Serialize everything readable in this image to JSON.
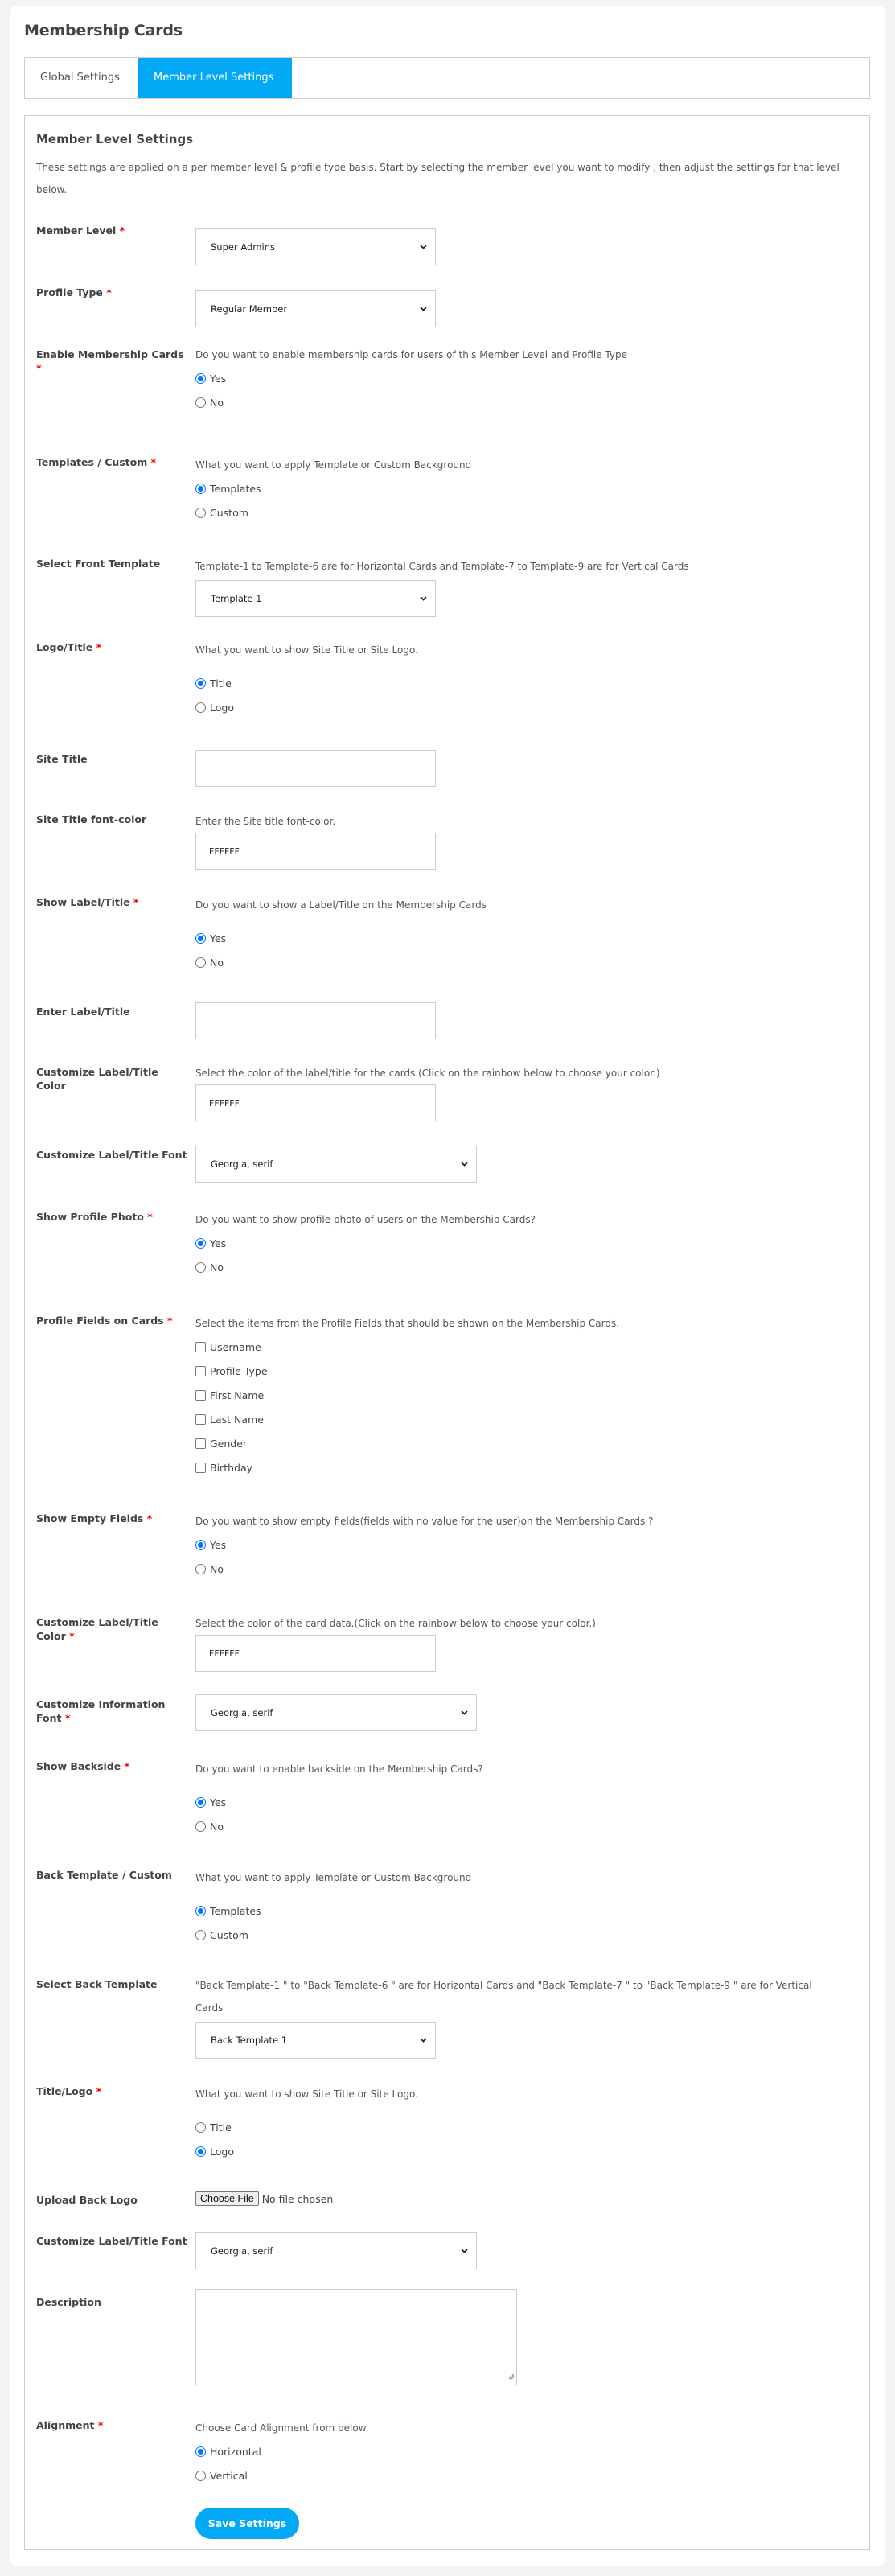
{
  "page": {
    "title": "Membership Cards"
  },
  "tabs": [
    {
      "label": "Global Settings",
      "active": false
    },
    {
      "label": "Member Level Settings",
      "active": true
    }
  ],
  "panel": {
    "title": "Member Level Settings",
    "description": "These settings are applied on a per member level & profile type basis. Start by selecting the member level you want to modify , then adjust the settings for that level below."
  },
  "colors": {
    "accent": "#03a9f4",
    "required": "#ee0000",
    "radio_checked": "#0075ff"
  },
  "fields": {
    "member_level": {
      "label": "Member Level",
      "required": "*",
      "value": "Super Admins"
    },
    "profile_type": {
      "label": "Profile Type",
      "required": "*",
      "value": "Regular Member"
    },
    "enable_cards": {
      "label": "Enable Membership Cards",
      "required": "*",
      "hint": "Do you want to enable membership cards for users of this Member Level and Profile Type",
      "options": [
        {
          "label": "Yes",
          "checked": true
        },
        {
          "label": "No",
          "checked": false
        }
      ]
    },
    "templates_custom": {
      "label": "Templates / Custom",
      "required": "*",
      "hint": "What you want to apply Template or Custom Background",
      "options": [
        {
          "label": "Templates",
          "checked": true
        },
        {
          "label": "Custom",
          "checked": false
        }
      ]
    },
    "front_template": {
      "label": "Select Front Template",
      "hint": "Template-1 to Template-6 are for Horizontal Cards and Template-7 to Template-9 are for Vertical Cards",
      "value": "Template 1"
    },
    "logo_title": {
      "label": "Logo/Title",
      "required": "*",
      "hint": "What you want to show Site Title or Site Logo.",
      "options": [
        {
          "label": "Title",
          "checked": true
        },
        {
          "label": "Logo",
          "checked": false
        }
      ]
    },
    "site_title": {
      "label": "Site Title",
      "value": ""
    },
    "site_title_color": {
      "label": "Site Title font-color",
      "hint": "Enter the Site title font-color.",
      "value": "FFFFFF"
    },
    "show_label": {
      "label": "Show Label/Title",
      "required": "*",
      "hint": "Do you want to show a Label/Title on the Membership Cards",
      "options": [
        {
          "label": "Yes",
          "checked": true
        },
        {
          "label": "No",
          "checked": false
        }
      ]
    },
    "enter_label": {
      "label": "Enter Label/Title",
      "value": ""
    },
    "label_color": {
      "label": "Customize Label/Title Color",
      "hint": "Select the color of the label/title for the cards.(Click on the rainbow below to choose your color.)",
      "value": "FFFFFF"
    },
    "label_font": {
      "label": "Customize Label/Title Font",
      "value": "Georgia, serif"
    },
    "show_photo": {
      "label": "Show Profile Photo",
      "required": "*",
      "hint": "Do you want to show profile photo of users on the Membership Cards?",
      "options": [
        {
          "label": "Yes",
          "checked": true
        },
        {
          "label": "No",
          "checked": false
        }
      ]
    },
    "profile_fields": {
      "label": "Profile Fields on Cards",
      "required": "*",
      "hint": "Select the items from the Profile Fields that should be shown on the Membership Cards.",
      "options": [
        {
          "label": "Username",
          "checked": false
        },
        {
          "label": "Profile Type",
          "checked": false
        },
        {
          "label": "First Name",
          "checked": false
        },
        {
          "label": "Last Name",
          "checked": false
        },
        {
          "label": "Gender",
          "checked": false
        },
        {
          "label": "Birthday",
          "checked": false
        }
      ]
    },
    "show_empty": {
      "label": "Show Empty Fields",
      "required": "*",
      "hint": "Do you want to show empty fields(fields with no value for the user)on the Membership Cards ?",
      "options": [
        {
          "label": "Yes",
          "checked": true
        },
        {
          "label": "No",
          "checked": false
        }
      ]
    },
    "data_color": {
      "label": "Customize Label/Title Color",
      "required": "*",
      "hint": "Select the color of the card data.(Click on the rainbow below to choose your color.)",
      "value": "FFFFFF"
    },
    "info_font": {
      "label": "Customize Information Font",
      "required": "*",
      "value": "Georgia, serif"
    },
    "show_backside": {
      "label": "Show Backside",
      "required": "*",
      "hint": "Do you want to enable backside on the Membership Cards?",
      "options": [
        {
          "label": "Yes",
          "checked": true
        },
        {
          "label": "No",
          "checked": false
        }
      ]
    },
    "back_templates_custom": {
      "label": "Back Template / Custom",
      "hint": "What you want to apply Template or Custom Background",
      "options": [
        {
          "label": "Templates",
          "checked": true
        },
        {
          "label": "Custom",
          "checked": false
        }
      ]
    },
    "back_template": {
      "label": "Select Back Template",
      "hint": "\"Back Template-1 \" to \"Back Template-6 \" are for Horizontal Cards and \"Back Template-7 \" to \"Back Template-9 \" are for Vertical Cards",
      "value": "Back Template 1"
    },
    "title_logo": {
      "label": "Title/Logo",
      "required": "*",
      "hint": "What you want to show Site Title or Site Logo.",
      "options": [
        {
          "label": "Title",
          "checked": false
        },
        {
          "label": "Logo",
          "checked": true
        }
      ]
    },
    "upload_back_logo": {
      "label": "Upload Back Logo",
      "button": "Choose File",
      "status": "No file chosen"
    },
    "back_label_font": {
      "label": "Customize Label/Title Font",
      "value": "Georgia, serif"
    },
    "description": {
      "label": "Description",
      "value": ""
    },
    "alignment": {
      "label": "Alignment",
      "required": "*",
      "hint": "Choose Card Alignment from below",
      "options": [
        {
          "label": "Horizontal",
          "checked": true
        },
        {
          "label": "Vertical",
          "checked": false
        }
      ]
    }
  },
  "actions": {
    "save_label": "Save Settings"
  }
}
